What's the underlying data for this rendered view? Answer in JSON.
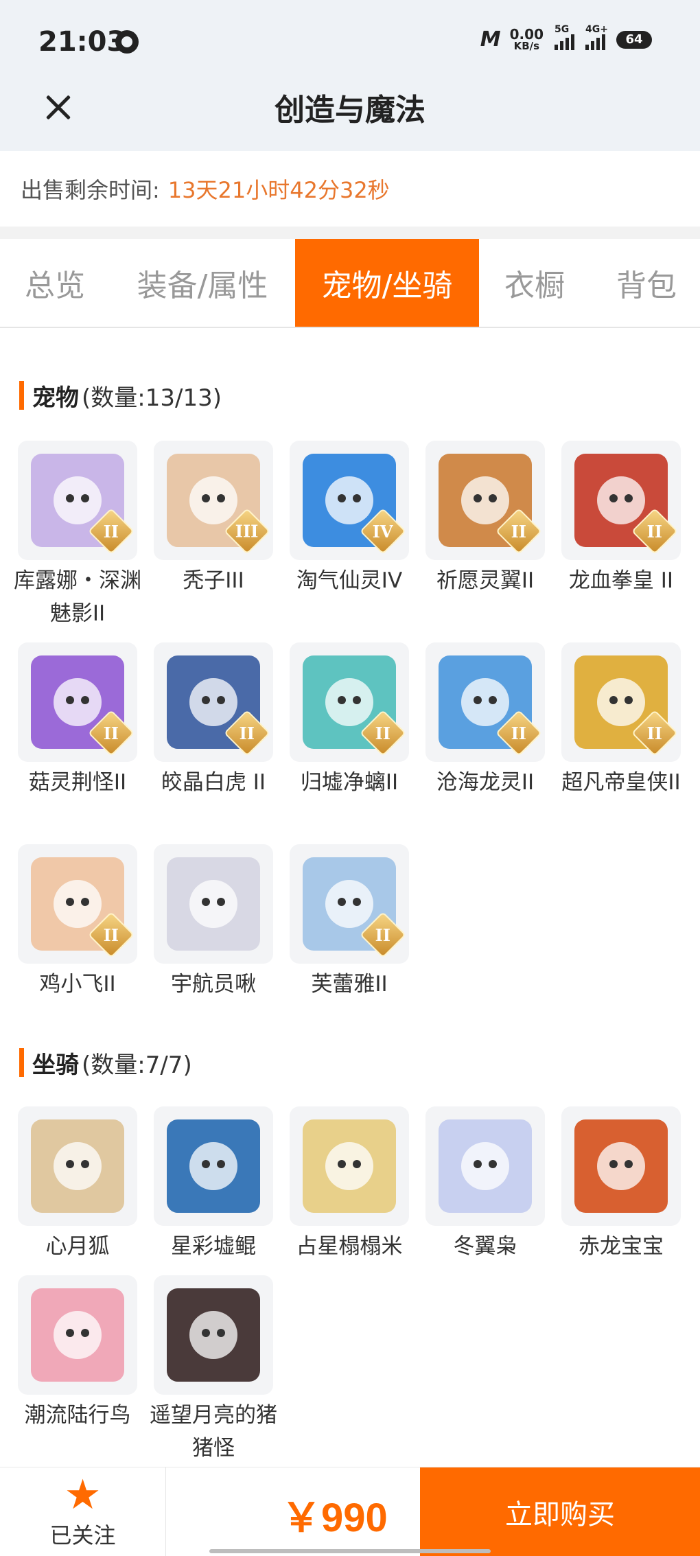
{
  "status_bar": {
    "time": "21:03",
    "net_speed_value": "0.00",
    "net_speed_unit": "KB/s",
    "signal1_label": "5G",
    "signal2_label": "4G+",
    "battery": "64"
  },
  "nav": {
    "title": "创造与魔法"
  },
  "sale": {
    "label": "出售剩余时间:",
    "remaining": "13天21小时42分32秒"
  },
  "tabs": [
    {
      "label": "总览"
    },
    {
      "label": "装备/属性"
    },
    {
      "label": "宠物/坐骑",
      "active": true
    },
    {
      "label": "衣橱"
    },
    {
      "label": "背包"
    }
  ],
  "pets": {
    "title": "宠物",
    "count": "(数量:13/13)",
    "items": [
      {
        "name": "库露娜・深渊魅影II",
        "badge": "II",
        "color": "#c9b6e8",
        "icon": "pet-avatar"
      },
      {
        "name": "秃子III",
        "badge": "III",
        "color": "#e8c7a8",
        "icon": "pet-avatar"
      },
      {
        "name": "淘气仙灵IV",
        "badge": "IV",
        "color": "#3d8de0",
        "icon": "pet-avatar"
      },
      {
        "name": "祈愿灵翼II",
        "badge": "II",
        "color": "#d08a4a",
        "icon": "pet-avatar"
      },
      {
        "name": "龙血拳皇 II",
        "badge": "II",
        "color": "#c94a3a",
        "icon": "pet-avatar"
      },
      {
        "name": "菇灵荆怪II",
        "badge": "II",
        "color": "#9b6ad8",
        "icon": "pet-avatar"
      },
      {
        "name": "皎晶白虎 II",
        "badge": "II",
        "color": "#4a6aa8",
        "icon": "pet-avatar"
      },
      {
        "name": "归墟净螭II",
        "badge": "II",
        "color": "#5ec3c0",
        "icon": "pet-avatar"
      },
      {
        "name": "沧海龙灵II",
        "badge": "II",
        "color": "#5aa0e0",
        "icon": "pet-avatar"
      },
      {
        "name": "超凡帝皇侠II",
        "badge": "II",
        "color": "#e0b040",
        "icon": "pet-avatar"
      },
      {
        "name": "鸡小飞II",
        "badge": "II",
        "color": "#f0c8a8",
        "icon": "pet-avatar"
      },
      {
        "name": "宇航员啾",
        "badge": "",
        "color": "#d8d8e4",
        "icon": "pet-avatar"
      },
      {
        "name": "芙蕾雅II",
        "badge": "II",
        "color": "#a8c8e8",
        "icon": "pet-avatar"
      }
    ]
  },
  "mounts": {
    "title": "坐骑",
    "count": "(数量:7/7)",
    "items": [
      {
        "name": "心月狐",
        "color": "#e0c8a0",
        "icon": "mount-avatar"
      },
      {
        "name": "星彩墟鲲",
        "color": "#3a78b8",
        "icon": "mount-avatar"
      },
      {
        "name": "占星榻榻米",
        "color": "#e8d08a",
        "icon": "mount-avatar"
      },
      {
        "name": "冬翼枭",
        "color": "#c8d0f0",
        "icon": "mount-avatar"
      },
      {
        "name": "赤龙宝宝",
        "color": "#d86030",
        "icon": "mount-avatar"
      },
      {
        "name": "潮流陆行鸟",
        "color": "#f0a8b8",
        "icon": "mount-avatar"
      },
      {
        "name": "遥望月亮的猪猪怪",
        "color": "#4a3a3a",
        "icon": "mount-avatar"
      }
    ]
  },
  "bottom": {
    "follow_label": "已关注",
    "star_icon": "★",
    "price": "￥990",
    "buy_label": "立即购买"
  }
}
